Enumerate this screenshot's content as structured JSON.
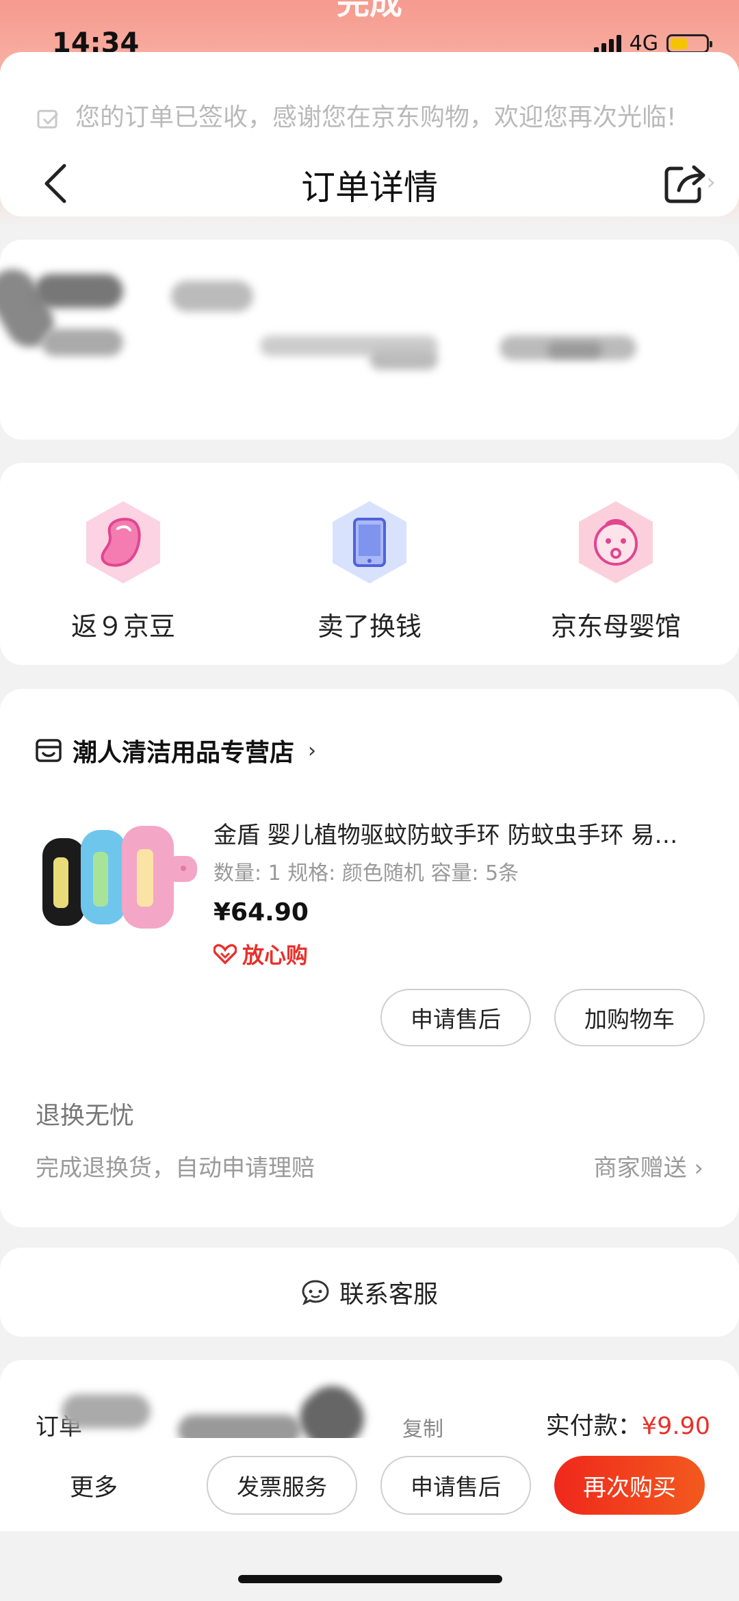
{
  "status_bar": {
    "time": "14:34",
    "network": "4G"
  },
  "header": {
    "done_text": "完成",
    "title": "订单详情",
    "signed_message": "您的订单已签收，感谢您在京东购物，欢迎您再次光临!",
    "signed_arrow": "›"
  },
  "quick_actions": [
    {
      "label": "返９京豆",
      "icon": "bean-icon"
    },
    {
      "label": "卖了换钱",
      "icon": "phone-icon"
    },
    {
      "label": "京东母婴馆",
      "icon": "baby-icon"
    }
  ],
  "order": {
    "store_name": "潮人清洁用品专营店",
    "store_chevron": "›",
    "product": {
      "title": "金盾 婴儿植物驱蚊防蚊手环 防蚊虫手环 易…",
      "spec": "数量: 1  规格: 颜色随机  容量: 5条",
      "price": "¥64.90",
      "assurance": "放心购"
    },
    "buttons": {
      "after_sale": "申请售后",
      "add_cart": "加购物车"
    },
    "returns": {
      "title": "退换无忧",
      "desc": "完成退换货，自动申请理赔",
      "right": "商家赠送 ›"
    }
  },
  "service": {
    "label": "联系客服"
  },
  "order_info": {
    "label": "订单",
    "copy": "复制",
    "paid_label": "实付款：",
    "paid_value": "¥9.90"
  },
  "bottom_bar": {
    "more": "更多",
    "invoice": "发票服务",
    "after_sale": "申请售后",
    "buy_again": "再次购买"
  },
  "colors": {
    "accent": "#e8312b",
    "header": "#f59a8e"
  }
}
